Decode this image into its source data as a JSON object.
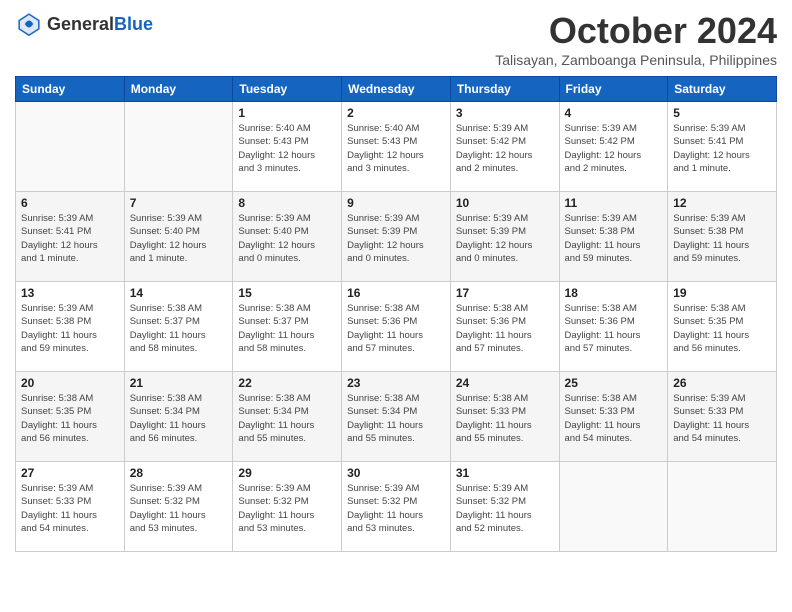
{
  "header": {
    "logo_general": "General",
    "logo_blue": "Blue",
    "month": "October 2024",
    "location": "Talisayan, Zamboanga Peninsula, Philippines"
  },
  "weekdays": [
    "Sunday",
    "Monday",
    "Tuesday",
    "Wednesday",
    "Thursday",
    "Friday",
    "Saturday"
  ],
  "weeks": [
    [
      {
        "day": "",
        "detail": ""
      },
      {
        "day": "",
        "detail": ""
      },
      {
        "day": "1",
        "detail": "Sunrise: 5:40 AM\nSunset: 5:43 PM\nDaylight: 12 hours\nand 3 minutes."
      },
      {
        "day": "2",
        "detail": "Sunrise: 5:40 AM\nSunset: 5:43 PM\nDaylight: 12 hours\nand 3 minutes."
      },
      {
        "day": "3",
        "detail": "Sunrise: 5:39 AM\nSunset: 5:42 PM\nDaylight: 12 hours\nand 2 minutes."
      },
      {
        "day": "4",
        "detail": "Sunrise: 5:39 AM\nSunset: 5:42 PM\nDaylight: 12 hours\nand 2 minutes."
      },
      {
        "day": "5",
        "detail": "Sunrise: 5:39 AM\nSunset: 5:41 PM\nDaylight: 12 hours\nand 1 minute."
      }
    ],
    [
      {
        "day": "6",
        "detail": "Sunrise: 5:39 AM\nSunset: 5:41 PM\nDaylight: 12 hours\nand 1 minute."
      },
      {
        "day": "7",
        "detail": "Sunrise: 5:39 AM\nSunset: 5:40 PM\nDaylight: 12 hours\nand 1 minute."
      },
      {
        "day": "8",
        "detail": "Sunrise: 5:39 AM\nSunset: 5:40 PM\nDaylight: 12 hours\nand 0 minutes."
      },
      {
        "day": "9",
        "detail": "Sunrise: 5:39 AM\nSunset: 5:39 PM\nDaylight: 12 hours\nand 0 minutes."
      },
      {
        "day": "10",
        "detail": "Sunrise: 5:39 AM\nSunset: 5:39 PM\nDaylight: 12 hours\nand 0 minutes."
      },
      {
        "day": "11",
        "detail": "Sunrise: 5:39 AM\nSunset: 5:38 PM\nDaylight: 11 hours\nand 59 minutes."
      },
      {
        "day": "12",
        "detail": "Sunrise: 5:39 AM\nSunset: 5:38 PM\nDaylight: 11 hours\nand 59 minutes."
      }
    ],
    [
      {
        "day": "13",
        "detail": "Sunrise: 5:39 AM\nSunset: 5:38 PM\nDaylight: 11 hours\nand 59 minutes."
      },
      {
        "day": "14",
        "detail": "Sunrise: 5:38 AM\nSunset: 5:37 PM\nDaylight: 11 hours\nand 58 minutes."
      },
      {
        "day": "15",
        "detail": "Sunrise: 5:38 AM\nSunset: 5:37 PM\nDaylight: 11 hours\nand 58 minutes."
      },
      {
        "day": "16",
        "detail": "Sunrise: 5:38 AM\nSunset: 5:36 PM\nDaylight: 11 hours\nand 57 minutes."
      },
      {
        "day": "17",
        "detail": "Sunrise: 5:38 AM\nSunset: 5:36 PM\nDaylight: 11 hours\nand 57 minutes."
      },
      {
        "day": "18",
        "detail": "Sunrise: 5:38 AM\nSunset: 5:36 PM\nDaylight: 11 hours\nand 57 minutes."
      },
      {
        "day": "19",
        "detail": "Sunrise: 5:38 AM\nSunset: 5:35 PM\nDaylight: 11 hours\nand 56 minutes."
      }
    ],
    [
      {
        "day": "20",
        "detail": "Sunrise: 5:38 AM\nSunset: 5:35 PM\nDaylight: 11 hours\nand 56 minutes."
      },
      {
        "day": "21",
        "detail": "Sunrise: 5:38 AM\nSunset: 5:34 PM\nDaylight: 11 hours\nand 56 minutes."
      },
      {
        "day": "22",
        "detail": "Sunrise: 5:38 AM\nSunset: 5:34 PM\nDaylight: 11 hours\nand 55 minutes."
      },
      {
        "day": "23",
        "detail": "Sunrise: 5:38 AM\nSunset: 5:34 PM\nDaylight: 11 hours\nand 55 minutes."
      },
      {
        "day": "24",
        "detail": "Sunrise: 5:38 AM\nSunset: 5:33 PM\nDaylight: 11 hours\nand 55 minutes."
      },
      {
        "day": "25",
        "detail": "Sunrise: 5:38 AM\nSunset: 5:33 PM\nDaylight: 11 hours\nand 54 minutes."
      },
      {
        "day": "26",
        "detail": "Sunrise: 5:39 AM\nSunset: 5:33 PM\nDaylight: 11 hours\nand 54 minutes."
      }
    ],
    [
      {
        "day": "27",
        "detail": "Sunrise: 5:39 AM\nSunset: 5:33 PM\nDaylight: 11 hours\nand 54 minutes."
      },
      {
        "day": "28",
        "detail": "Sunrise: 5:39 AM\nSunset: 5:32 PM\nDaylight: 11 hours\nand 53 minutes."
      },
      {
        "day": "29",
        "detail": "Sunrise: 5:39 AM\nSunset: 5:32 PM\nDaylight: 11 hours\nand 53 minutes."
      },
      {
        "day": "30",
        "detail": "Sunrise: 5:39 AM\nSunset: 5:32 PM\nDaylight: 11 hours\nand 53 minutes."
      },
      {
        "day": "31",
        "detail": "Sunrise: 5:39 AM\nSunset: 5:32 PM\nDaylight: 11 hours\nand 52 minutes."
      },
      {
        "day": "",
        "detail": ""
      },
      {
        "day": "",
        "detail": ""
      }
    ]
  ]
}
